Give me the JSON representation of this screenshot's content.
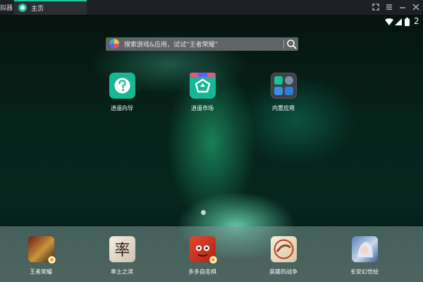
{
  "titlebar": {
    "app_title": "拟器",
    "tab_label": "主页",
    "controls": [
      "expand-icon",
      "menu-icon",
      "minimize-icon",
      "close-icon"
    ]
  },
  "statusbar": {
    "icons": [
      "wifi-icon",
      "signal-icon",
      "battery-icon"
    ],
    "clock": "2"
  },
  "search": {
    "placeholder": "搜索游戏&应用，试试“王者荣耀”"
  },
  "desktop": {
    "apps": [
      {
        "label": "逍遥向导",
        "icon": "help-question-icon"
      },
      {
        "label": "逍遥市场",
        "icon": "market-icon"
      },
      {
        "label": "内置应用",
        "icon": "folder-icon"
      }
    ]
  },
  "dock": {
    "apps": [
      {
        "label": "王者荣耀",
        "icon": "king-glory-game-icon"
      },
      {
        "label": "率土之滨",
        "icon": "shuaitu-game-icon"
      },
      {
        "label": "多多自走棋",
        "icon": "auto-chess-game-icon"
      },
      {
        "label": "英雄的战争",
        "icon": "hero-war-game-icon"
      },
      {
        "label": "长安幻世绘",
        "icon": "changan-game-icon"
      }
    ]
  },
  "colors": {
    "accent": "#19c39a",
    "titlebar_bg": "#1d2024",
    "search_bg": "#5f6467"
  }
}
